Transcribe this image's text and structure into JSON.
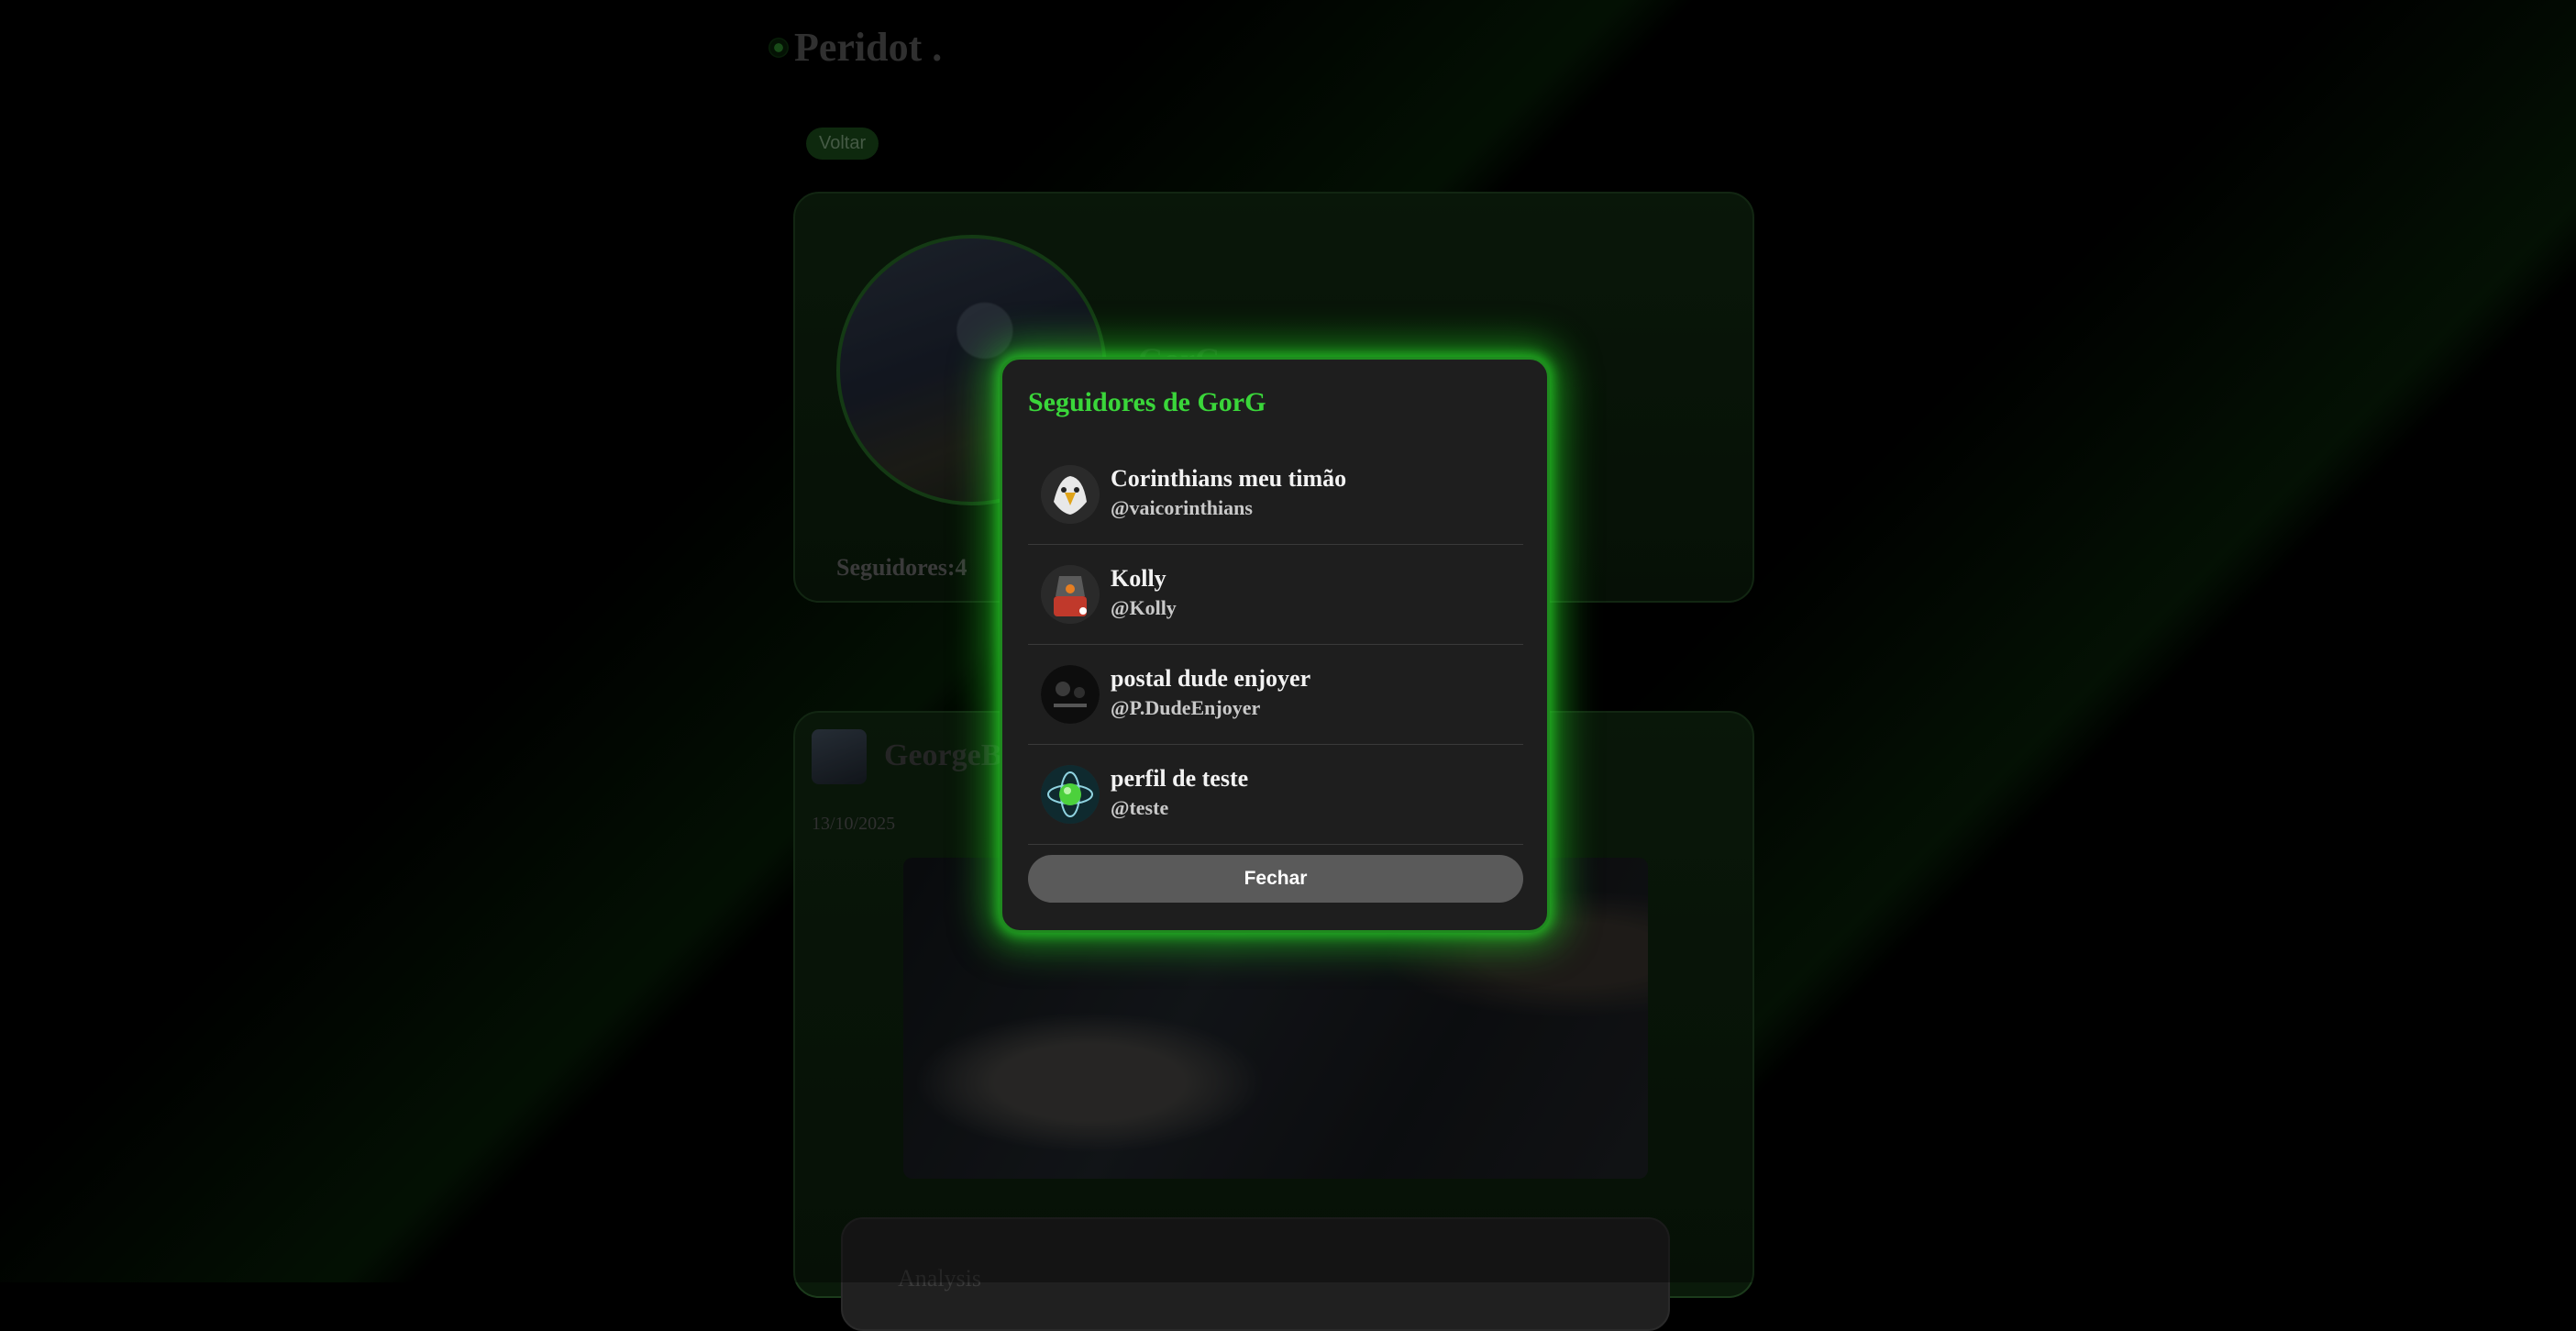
{
  "brand": {
    "name": "Peridot .",
    "logo_icon": "peridot-logo-icon"
  },
  "nav": {
    "back_label": "Voltar"
  },
  "profile": {
    "name": "GorG",
    "followers_label": "Seguidores:4"
  },
  "post": {
    "author": "GeorgeB",
    "date": "13/10/2025",
    "comment_label": "Analysis"
  },
  "modal": {
    "title": "Seguidores de GorG",
    "close_label": "Fechar",
    "accent_color": "#3ad63a",
    "followers": [
      {
        "name": "Corinthians meu timão",
        "handle": "@vaicorinthians",
        "avatar_icon": "eagle-avatar-icon"
      },
      {
        "name": "Kolly",
        "handle": "@Kolly",
        "avatar_icon": "robot-avatar-icon"
      },
      {
        "name": "postal dude enjoyer",
        "handle": "@P.DudeEnjoyer",
        "avatar_icon": "dark-avatar-icon"
      },
      {
        "name": "perfil de teste",
        "handle": "@teste",
        "avatar_icon": "atom-avatar-icon"
      }
    ]
  }
}
